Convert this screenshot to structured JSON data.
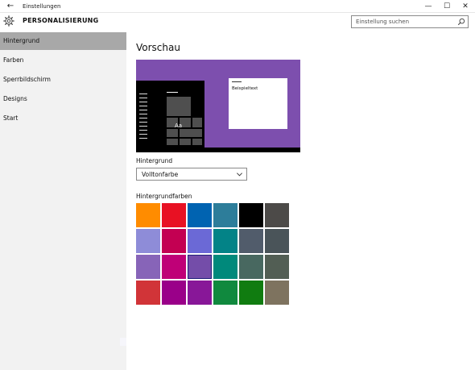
{
  "window": {
    "title": "Einstellungen",
    "back_glyph": "←",
    "minimize_glyph": "—",
    "maximize_glyph": "☐",
    "close_glyph": "✕"
  },
  "header": {
    "section_title": "PERSONALISIERUNG",
    "search_placeholder": "Einstellung suchen",
    "icons": {
      "gear": "gear-icon",
      "search": "search-icon"
    }
  },
  "sidebar": {
    "items": [
      {
        "label": "Hintergrund",
        "active": true
      },
      {
        "label": "Farben",
        "active": false
      },
      {
        "label": "Sperrbildschirm",
        "active": false
      },
      {
        "label": "Designs",
        "active": false
      },
      {
        "label": "Start",
        "active": false
      }
    ]
  },
  "main": {
    "heading": "Vorschau",
    "preview": {
      "tile_label": "Aa",
      "window_text": "Beispieltext",
      "background_color": "#7d4fae"
    },
    "background_label": "Hintergrund",
    "background_value": "Volltonfarbe",
    "colors_label": "Hintergrundfarben",
    "selected_color": "#744da9",
    "colors": [
      [
        "#ff8c00",
        "#e81123",
        "#0063b1",
        "#2d7d9a",
        "#000000",
        "#4c4a48"
      ],
      [
        "#8e8cd8",
        "#c30052",
        "#6b69d6",
        "#038387",
        "#515c6b",
        "#4a5459"
      ],
      [
        "#8764b8",
        "#bf0077",
        "#744da9",
        "#00897b",
        "#486860",
        "#525e54"
      ],
      [
        "#d13438",
        "#9a0089",
        "#881798",
        "#10893e",
        "#107c10",
        "#7e735f"
      ]
    ]
  },
  "colors": {
    "sidebar_bg": "#f2f2f2",
    "sidebar_active": "#a8a8a8"
  }
}
